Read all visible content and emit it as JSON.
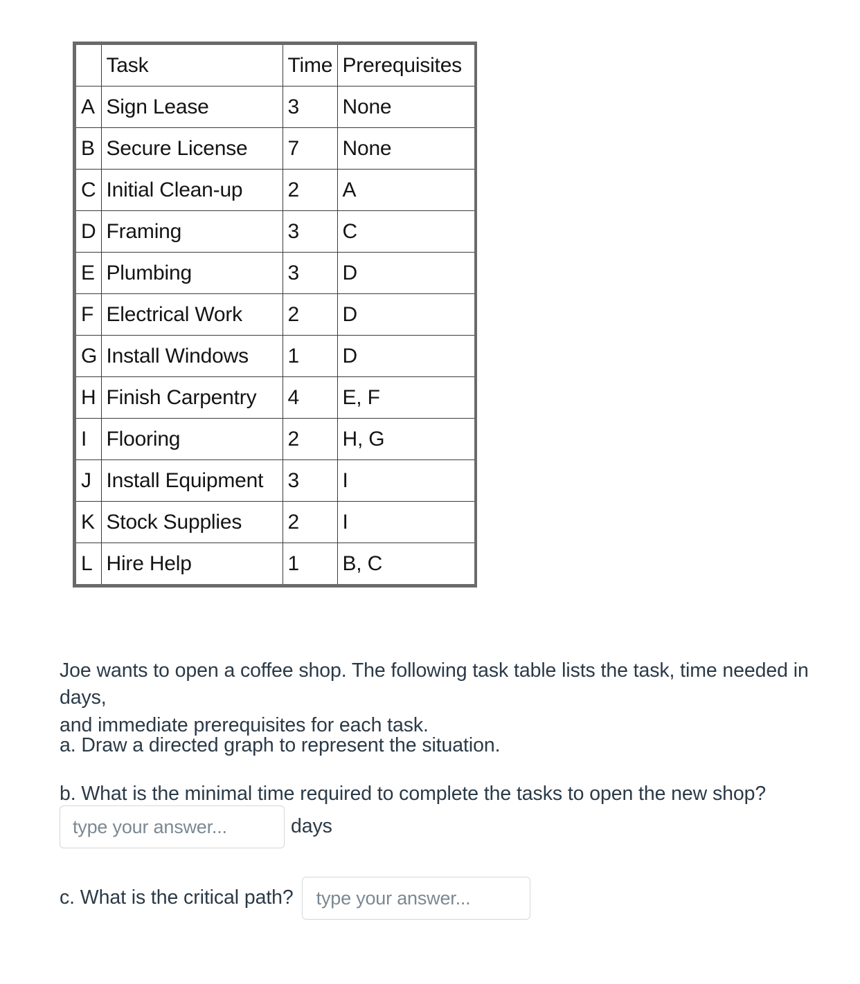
{
  "table": {
    "headers": {
      "letter": "",
      "task": "Task",
      "time": "Time",
      "prereq": "Prerequisites"
    },
    "rows": [
      {
        "letter": "A",
        "task": "Sign Lease",
        "time": "3",
        "prereq": "None"
      },
      {
        "letter": "B",
        "task": "Secure License",
        "time": "7",
        "prereq": "None"
      },
      {
        "letter": "C",
        "task": "Initial Clean-up",
        "time": "2",
        "prereq": "A"
      },
      {
        "letter": "D",
        "task": "Framing",
        "time": "3",
        "prereq": "C"
      },
      {
        "letter": "E",
        "task": "Plumbing",
        "time": "3",
        "prereq": "D"
      },
      {
        "letter": "F",
        "task": "Electrical Work",
        "time": "2",
        "prereq": "D"
      },
      {
        "letter": "G",
        "task": "Install Windows",
        "time": "1",
        "prereq": "D"
      },
      {
        "letter": "H",
        "task": "Finish Carpentry",
        "time": "4",
        "prereq": "E, F"
      },
      {
        "letter": "I",
        "task": "Flooring",
        "time": "2",
        "prereq": "H, G"
      },
      {
        "letter": "J",
        "task": "Install Equipment",
        "time": "3",
        "prereq": "I"
      },
      {
        "letter": "K",
        "task": "Stock Supplies",
        "time": "2",
        "prereq": "I"
      },
      {
        "letter": "L",
        "task": "Hire Help",
        "time": "1",
        "prereq": "B, C"
      }
    ]
  },
  "prompt": {
    "intro_line1": "Joe wants to open a coffee shop. The following task table lists the task, time needed in days,",
    "intro_line2": "and immediate prerequisites for each task."
  },
  "questions": {
    "a": "a. Draw a directed graph to represent the situation.",
    "b": "b. What is the minimal time required to complete the tasks to open the new shop?",
    "c_label": "c. What is the critical path?"
  },
  "answers": {
    "b_value": "",
    "b_placeholder": "type your answer...",
    "b_unit": "days",
    "c_value": "",
    "c_placeholder": "type your answer..."
  },
  "colors": {
    "text": "#2b3a47",
    "table_text": "#141414",
    "table_outer_border": "#6a6a6a",
    "table_inner_border": "#3a3a3a",
    "input_border": "#d3d7db",
    "placeholder": "#7b8892",
    "background": "#ffffff"
  }
}
